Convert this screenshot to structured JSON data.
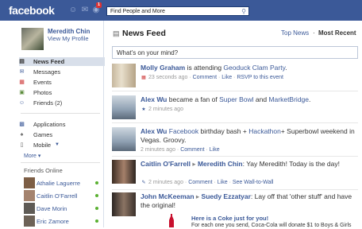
{
  "topbar": {
    "logo": "facebook",
    "search_placeholder": "Find People and More",
    "notification_count": "1",
    "colors": {
      "bar": "#3b5998",
      "badge": "#dd3333"
    }
  },
  "sidebar": {
    "profile_name": "Meredith Chin",
    "view_profile": "View My Profile",
    "nav": [
      {
        "label": "News Feed",
        "icon": "news-feed-icon"
      },
      {
        "label": "Messages",
        "icon": "messages-icon"
      },
      {
        "label": "Events",
        "icon": "events-icon"
      },
      {
        "label": "Photos",
        "icon": "photos-icon"
      },
      {
        "label": "Friends (2)",
        "icon": "friends-icon"
      }
    ],
    "apps": [
      {
        "label": "Applications",
        "icon": "applications-icon"
      },
      {
        "label": "Games",
        "icon": "games-icon"
      },
      {
        "label": "Mobile",
        "icon": "mobile-icon"
      }
    ],
    "more": "More ▾",
    "friends_online_title": "Friends Online",
    "friends_online": [
      {
        "name": "Athalie Laguerre"
      },
      {
        "name": "Caitlin O'Farrell"
      },
      {
        "name": "Dave Morin"
      },
      {
        "name": "Eric Zamore"
      }
    ]
  },
  "main": {
    "title": "News Feed",
    "top_news": "Top News",
    "separator": "·",
    "most_recent": "Most Recent",
    "status_placeholder": "What's on your mind?",
    "stories": [
      {
        "actor": "Molly Graham",
        "text": " is attending ",
        "target": "Geoduck Clam Party",
        "end": ".",
        "time": "23 seconds ago",
        "actions": [
          "Comment",
          "Like",
          "RSVP to this event"
        ]
      },
      {
        "actor": "Alex Wu",
        "text": " became a fan of ",
        "target": "Super Bowl",
        "mid": " and ",
        "target2": "MarketBridge",
        "end": ".",
        "time": "2 minutes ago"
      },
      {
        "actor": "Alex Wu",
        "target": "Facebook",
        "text": " birthday bash + ",
        "target2": "Hackathon",
        "end": "+ Superbowl weekend in Vegas. Groovy.",
        "time": "2 minutes ago",
        "actions": [
          "Comment",
          "Like"
        ]
      },
      {
        "actor": "Caitlin O'Farrell",
        "arrow": " ▸ ",
        "target": "Meredith Chin",
        "text": ": Yay Meredith! Today is the day!",
        "time": "2 minutes ago",
        "actions": [
          "Comment",
          "Like",
          "See Wall-to-Wall"
        ]
      },
      {
        "actor": "John McKeeman",
        "arrow": " ▸ ",
        "target": "Suedy Ezzatyar",
        "text": ": Lay off that 'other stuff' and have the original!",
        "ad_title": "Here is a Coke just for you!",
        "ad_body": "For each one you send, Coca-Cola will donate $1 to Boys & Girls"
      }
    ]
  }
}
